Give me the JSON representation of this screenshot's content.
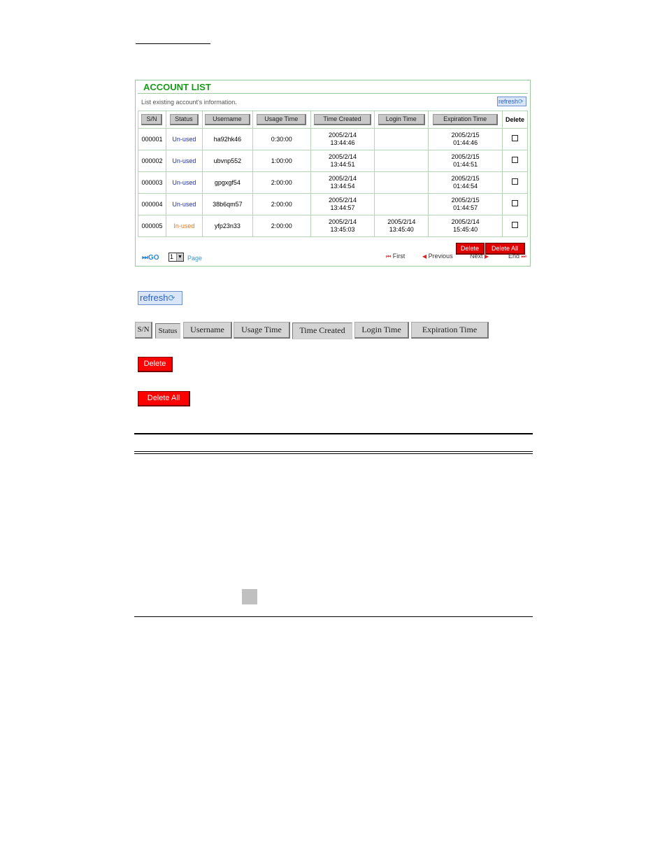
{
  "panel": {
    "title": "ACCOUNT LIST",
    "description": "List existing account's information.",
    "refresh_label": "refresh",
    "columns": [
      "S/N",
      "Status",
      "Username",
      "Usage Time",
      "Time Created",
      "Login Time",
      "Expiration Time",
      "Delete"
    ],
    "rows": [
      {
        "sn": "000001",
        "status": "Un-used",
        "username": "ha92hk46",
        "usage": "0:30:00",
        "created_date": "2005/2/14",
        "created_time": "13:44:46",
        "login_date": "",
        "login_time": "",
        "exp_date": "2005/2/15",
        "exp_time": "01:44:46"
      },
      {
        "sn": "000002",
        "status": "Un-used",
        "username": "ubvnp552",
        "usage": "1:00:00",
        "created_date": "2005/2/14",
        "created_time": "13:44:51",
        "login_date": "",
        "login_time": "",
        "exp_date": "2005/2/15",
        "exp_time": "01:44:51"
      },
      {
        "sn": "000003",
        "status": "Un-used",
        "username": "gpgxgf54",
        "usage": "2:00:00",
        "created_date": "2005/2/14",
        "created_time": "13:44:54",
        "login_date": "",
        "login_time": "",
        "exp_date": "2005/2/15",
        "exp_time": "01:44:54"
      },
      {
        "sn": "000004",
        "status": "Un-used",
        "username": "38b6qm57",
        "usage": "2:00:00",
        "created_date": "2005/2/14",
        "created_time": "13:44:57",
        "login_date": "",
        "login_time": "",
        "exp_date": "2005/2/15",
        "exp_time": "01:44:57"
      },
      {
        "sn": "000005",
        "status": "In-used",
        "username": "yfp23n33",
        "usage": "2:00:00",
        "created_date": "2005/2/14",
        "created_time": "13:45:03",
        "login_date": "2005/2/14",
        "login_time": "13:45:40",
        "exp_date": "2005/2/14",
        "exp_time": "15:45:40"
      }
    ],
    "delete_label": "Delete",
    "delete_all_label": "Delete All",
    "go_label": "GO",
    "page_value": "1",
    "page_label": "Page",
    "nav": {
      "first": "First",
      "previous": "Previous",
      "next": "Next",
      "end": "End"
    }
  },
  "standalone": {
    "refresh_label": "refresh",
    "header_buttons": [
      "S/N",
      "Status",
      "Username",
      "Usage Time",
      "Time Created",
      "Login Time",
      "Expiration Time"
    ],
    "delete_label": "Delete",
    "delete_all_label": "Delete All"
  },
  "colors": {
    "title_green": "#1a9a1a",
    "unused_blue": "#1f2fa8",
    "inused_orange": "#e07a20",
    "delete_red": "#ff0000",
    "refresh_blue": "#3060c0"
  },
  "icons": [
    "refresh-icon",
    "go-icon",
    "first-icon",
    "previous-icon",
    "next-icon",
    "end-icon",
    "dropdown-arrow-icon"
  ]
}
